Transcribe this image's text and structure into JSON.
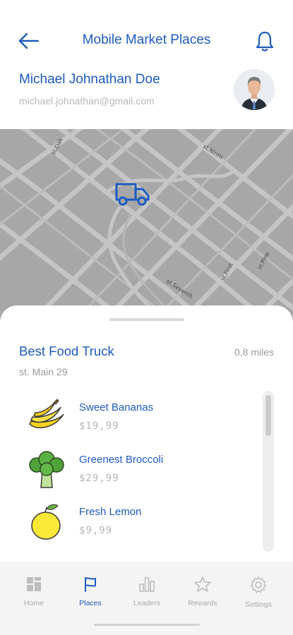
{
  "header": {
    "title": "Mobile Market Places",
    "back_icon": "arrow-left-icon",
    "notification_icon": "bell-icon"
  },
  "user": {
    "name": "Michael Johnathan Doe",
    "email": "michael.johnathan@gmail.com"
  },
  "map": {
    "streets": [
      "st.Oak",
      "st.Ninth",
      "st.Pine",
      "st.First",
      "st.Seventh"
    ],
    "marker_icon": "truck-icon"
  },
  "place": {
    "name": "Best Food Truck",
    "distance": "0,8 miles",
    "address": "st. Main 29",
    "items": [
      {
        "name": "Sweet Bananas",
        "price": "$19,99",
        "icon": "banana-icon"
      },
      {
        "name": "Greenest Broccoli",
        "price": "$29,99",
        "icon": "broccoli-icon"
      },
      {
        "name": "Fresh Lemon",
        "price": "$9,99",
        "icon": "lemon-icon"
      }
    ]
  },
  "tabs": [
    {
      "label": "Home",
      "icon": "grid-icon",
      "active": false
    },
    {
      "label": "Places",
      "icon": "flag-icon",
      "active": true
    },
    {
      "label": "Leaders",
      "icon": "bar-chart-icon",
      "active": false
    },
    {
      "label": "Rewards",
      "icon": "star-icon",
      "active": false
    },
    {
      "label": "Settings",
      "icon": "gear-icon",
      "active": false
    }
  ],
  "colors": {
    "accent": "#1e5bbf",
    "muted": "#b8b8b8",
    "map": "#a7a7a7"
  }
}
